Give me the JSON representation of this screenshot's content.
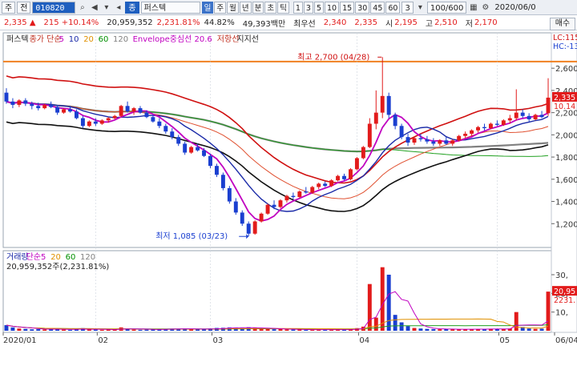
{
  "toolbar": {
    "market": "주",
    "mode": "전",
    "code": "010820",
    "name_icon": "종",
    "name": "퍼스텍",
    "periods": [
      "일",
      "주",
      "월",
      "년",
      "분",
      "초",
      "틱"
    ],
    "active_period": "일",
    "minutes": [
      "1",
      "3",
      "5",
      "10",
      "15",
      "30",
      "45",
      "60"
    ],
    "interval": "3",
    "count": "100/600",
    "date": "2020/06/0"
  },
  "quote": {
    "price": "2,335",
    "change": "215",
    "change_pct": "+10.14%",
    "volume": "20,959,352",
    "volume_pct": "2,231.81%",
    "turnover": "44.82%",
    "amount": "49,393백만",
    "best_ask_label": "최우선",
    "best_ask": "2,340",
    "best_bid": "2,335",
    "open_label": "시",
    "open": "2,195",
    "high_label": "고",
    "high": "2,510",
    "low_label": "저",
    "low": "2,170",
    "buy": "매수"
  },
  "price_panel": {
    "legend": [
      {
        "text": "퍼스텍",
        "color": "#222222"
      },
      {
        "text": "종가 단순",
        "color": "#c03020"
      },
      {
        "text": "5",
        "color": "#c000c0"
      },
      {
        "text": "10",
        "color": "#1a2aa8"
      },
      {
        "text": "20",
        "color": "#e09000"
      },
      {
        "text": "60",
        "color": "#009000"
      },
      {
        "text": "120",
        "color": "#808080"
      },
      {
        "text": "Envelope중심선 20.6",
        "color": "#c000c0"
      },
      {
        "text": "저항선",
        "color": "#c03020"
      },
      {
        "text": "지지선",
        "color": "#222222"
      }
    ],
    "high_note": "최고 2,700 (04/28)",
    "low_note": "최저 1,085 (03/23)",
    "lc_label": "LC:115",
    "hc_label": "HC:-13",
    "price_tag": "2,335",
    "price_tag2": "10.14",
    "y_ticks": [
      "2,600",
      "2,400",
      "2,200",
      "2,000",
      "1,800",
      "1,600",
      "1,400",
      "1,200"
    ]
  },
  "volume_panel": {
    "legend": [
      {
        "text": "거래량",
        "color": "#1a2aa8"
      },
      {
        "text": "단순",
        "color": "#c000c0"
      },
      {
        "text": "5",
        "color": "#c000c0"
      },
      {
        "text": "20",
        "color": "#e09000"
      },
      {
        "text": "60",
        "color": "#009000"
      },
      {
        "text": "120",
        "color": "#808080"
      }
    ],
    "info": "20,959,352주(2,231.81%)",
    "y_ticks": [
      "30,",
      "20,",
      "10,"
    ],
    "vol_tag": "20,95",
    "vol_tag2": "2231."
  },
  "x_ticks": [
    "2020/01",
    "02",
    "03",
    "04",
    "05",
    "06",
    "06/04"
  ],
  "chart_data": {
    "type": "candlestick",
    "ylim": [
      1000,
      2760
    ],
    "vol_ylim": [
      0,
      36
    ],
    "colors": {
      "up": "#e21b1b",
      "down": "#1a3fd0",
      "ma5": "#c000c0",
      "ma10": "#1a2aa8",
      "ma20_env": "#c000c0",
      "resist": "#d01010",
      "support": "#111111",
      "ma60": "#20a020",
      "ma120": "#808080",
      "band_orange": "#f08020"
    },
    "candles": [
      [
        2380,
        2420,
        2280,
        2300
      ],
      [
        2300,
        2330,
        2240,
        2270
      ],
      [
        2270,
        2320,
        2250,
        2310
      ],
      [
        2310,
        2330,
        2260,
        2280
      ],
      [
        2280,
        2300,
        2230,
        2260
      ],
      [
        2260,
        2290,
        2220,
        2240
      ],
      [
        2240,
        2280,
        2230,
        2270
      ],
      [
        2270,
        2300,
        2240,
        2250
      ],
      [
        2250,
        2270,
        2180,
        2200
      ],
      [
        2200,
        2240,
        2190,
        2230
      ],
      [
        2230,
        2260,
        2200,
        2210
      ],
      [
        2210,
        2230,
        2140,
        2150
      ],
      [
        2150,
        2170,
        2060,
        2080
      ],
      [
        2080,
        2130,
        2070,
        2120
      ],
      [
        2120,
        2150,
        2080,
        2100
      ],
      [
        2100,
        2140,
        2090,
        2130
      ],
      [
        2130,
        2160,
        2110,
        2150
      ],
      [
        2150,
        2180,
        2140,
        2170
      ],
      [
        2170,
        2270,
        2160,
        2260
      ],
      [
        2260,
        2300,
        2200,
        2210
      ],
      [
        2210,
        2250,
        2180,
        2240
      ],
      [
        2240,
        2260,
        2190,
        2200
      ],
      [
        2200,
        2220,
        2150,
        2160
      ],
      [
        2160,
        2180,
        2110,
        2120
      ],
      [
        2120,
        2150,
        2060,
        2080
      ],
      [
        2080,
        2100,
        2010,
        2030
      ],
      [
        2030,
        2060,
        1960,
        1980
      ],
      [
        1980,
        2000,
        1900,
        1920
      ],
      [
        1920,
        1940,
        1820,
        1840
      ],
      [
        1840,
        1900,
        1830,
        1890
      ],
      [
        1890,
        1920,
        1850,
        1860
      ],
      [
        1860,
        1880,
        1800,
        1810
      ],
      [
        1810,
        1830,
        1700,
        1720
      ],
      [
        1720,
        1740,
        1620,
        1640
      ],
      [
        1640,
        1660,
        1500,
        1520
      ],
      [
        1520,
        1540,
        1380,
        1400
      ],
      [
        1400,
        1430,
        1280,
        1300
      ],
      [
        1300,
        1320,
        1180,
        1200
      ],
      [
        1200,
        1220,
        1085,
        1110
      ],
      [
        1110,
        1230,
        1100,
        1220
      ],
      [
        1220,
        1300,
        1210,
        1290
      ],
      [
        1290,
        1380,
        1280,
        1370
      ],
      [
        1370,
        1410,
        1330,
        1350
      ],
      [
        1350,
        1420,
        1340,
        1410
      ],
      [
        1410,
        1460,
        1390,
        1450
      ],
      [
        1450,
        1480,
        1420,
        1440
      ],
      [
        1440,
        1500,
        1430,
        1490
      ],
      [
        1490,
        1530,
        1470,
        1480
      ],
      [
        1480,
        1540,
        1470,
        1530
      ],
      [
        1530,
        1570,
        1510,
        1560
      ],
      [
        1560,
        1580,
        1530,
        1540
      ],
      [
        1540,
        1600,
        1530,
        1590
      ],
      [
        1590,
        1640,
        1580,
        1630
      ],
      [
        1630,
        1650,
        1590,
        1600
      ],
      [
        1600,
        1700,
        1590,
        1690
      ],
      [
        1690,
        1800,
        1680,
        1790
      ],
      [
        1790,
        1900,
        1780,
        1890
      ],
      [
        1890,
        2150,
        1880,
        2100
      ],
      [
        2100,
        2400,
        2050,
        2200
      ],
      [
        2200,
        2700,
        2150,
        2350
      ],
      [
        2350,
        2380,
        2150,
        2180
      ],
      [
        2180,
        2200,
        2050,
        2080
      ],
      [
        2080,
        2100,
        1960,
        1980
      ],
      [
        1980,
        2010,
        1900,
        1930
      ],
      [
        1930,
        1980,
        1910,
        1970
      ],
      [
        1970,
        2010,
        1940,
        1960
      ],
      [
        1960,
        1990,
        1920,
        1940
      ],
      [
        1940,
        1970,
        1900,
        1920
      ],
      [
        1920,
        1960,
        1900,
        1950
      ],
      [
        1950,
        1980,
        1910,
        1920
      ],
      [
        1920,
        1960,
        1900,
        1950
      ],
      [
        1950,
        2000,
        1940,
        1990
      ],
      [
        1990,
        2030,
        1970,
        2010
      ],
      [
        2010,
        2050,
        1990,
        2040
      ],
      [
        2040,
        2080,
        2020,
        2070
      ],
      [
        2070,
        2100,
        2040,
        2060
      ],
      [
        2060,
        2110,
        2050,
        2100
      ],
      [
        2100,
        2130,
        2080,
        2090
      ],
      [
        2090,
        2140,
        2080,
        2130
      ],
      [
        2130,
        2180,
        2100,
        2150
      ],
      [
        2150,
        2410,
        2130,
        2200
      ],
      [
        2200,
        2230,
        2150,
        2170
      ],
      [
        2170,
        2195,
        2120,
        2140
      ],
      [
        2140,
        2190,
        2130,
        2180
      ],
      [
        2180,
        2215,
        2150,
        2160
      ],
      [
        2195,
        2510,
        2170,
        2335
      ]
    ],
    "volumes": [
      3.0,
      1.8,
      1.2,
      1.0,
      0.8,
      0.9,
      0.7,
      0.8,
      1.0,
      0.6,
      0.5,
      0.9,
      1.4,
      0.7,
      0.6,
      0.5,
      0.6,
      0.7,
      1.8,
      1.1,
      0.6,
      0.5,
      0.6,
      0.8,
      0.9,
      1.0,
      1.1,
      1.0,
      1.2,
      0.8,
      0.7,
      0.9,
      1.2,
      1.5,
      1.6,
      1.8,
      1.6,
      1.4,
      1.9,
      1.5,
      1.0,
      1.2,
      0.8,
      0.9,
      0.7,
      0.6,
      0.7,
      0.5,
      0.6,
      0.7,
      0.5,
      0.6,
      0.7,
      0.5,
      0.9,
      1.4,
      2.2,
      25.0,
      7.0,
      34.0,
      30.0,
      8.5,
      4.5,
      2.5,
      1.5,
      1.2,
      1.0,
      0.9,
      0.8,
      0.9,
      0.8,
      0.7,
      0.8,
      0.9,
      1.0,
      0.8,
      1.1,
      0.9,
      1.0,
      1.2,
      10.0,
      2.0,
      1.2,
      1.0,
      1.1,
      20.95
    ]
  }
}
